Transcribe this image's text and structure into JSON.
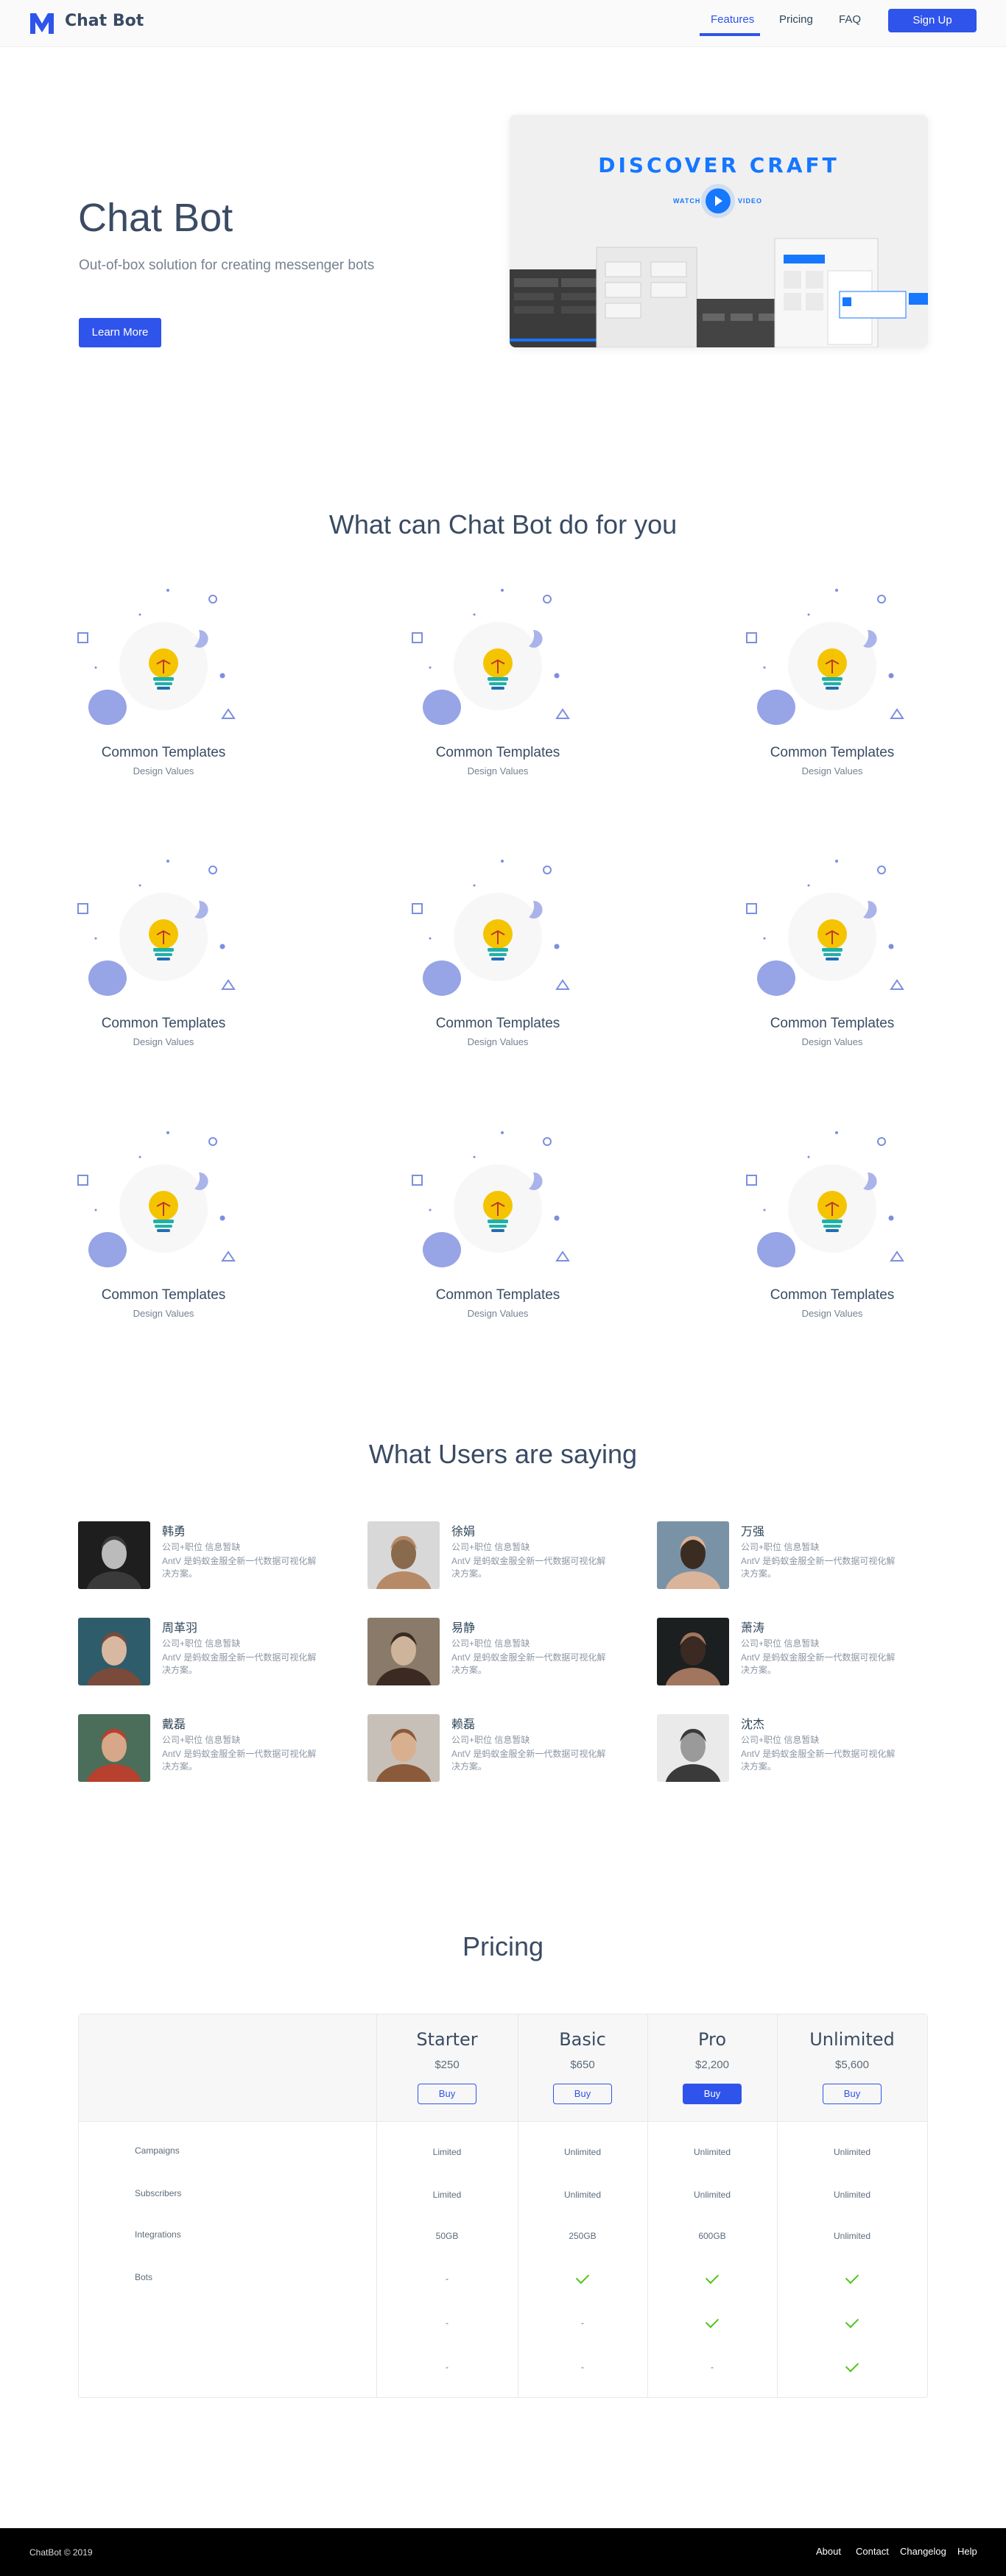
{
  "header": {
    "brand": "Chat Bot",
    "nav": [
      "Features",
      "Pricing",
      "FAQ"
    ],
    "signup": "Sign Up",
    "accent": "#2f54eb"
  },
  "hero": {
    "title": "Chat Bot",
    "subtitle": "Out-of-box solution for creating messenger bots",
    "button": "Learn More",
    "video": {
      "headline": "DISCOVER CRAFT",
      "watch": "WATCH",
      "video": "VIDEO"
    }
  },
  "features": {
    "title": "What can Chat Bot do for you",
    "items": [
      {
        "title": "Common Templates",
        "sub": "Design Values"
      },
      {
        "title": "Common Templates",
        "sub": "Design Values"
      },
      {
        "title": "Common Templates",
        "sub": "Design Values"
      },
      {
        "title": "Common Templates",
        "sub": "Design Values"
      },
      {
        "title": "Common Templates",
        "sub": "Design Values"
      },
      {
        "title": "Common Templates",
        "sub": "Design Values"
      },
      {
        "title": "Common Templates",
        "sub": "Design Values"
      },
      {
        "title": "Common Templates",
        "sub": "Design Values"
      },
      {
        "title": "Common Templates",
        "sub": "Design Values"
      }
    ]
  },
  "testimonials": {
    "title": "What Users are saying",
    "items": [
      {
        "name": "韩勇",
        "role": "公司+职位 信息暂缺",
        "desc": "AntV 是蚂蚁金服全新一代数据可视化解决方案。"
      },
      {
        "name": "徐娟",
        "role": "公司+职位 信息暂缺",
        "desc": "AntV 是蚂蚁金服全新一代数据可视化解决方案。"
      },
      {
        "name": "万强",
        "role": "公司+职位 信息暂缺",
        "desc": "AntV 是蚂蚁金服全新一代数据可视化解决方案。"
      },
      {
        "name": "周革羽",
        "role": "公司+职位 信息暂缺",
        "desc": "AntV 是蚂蚁金服全新一代数据可视化解决方案。"
      },
      {
        "name": "易静",
        "role": "公司+职位 信息暂缺",
        "desc": "AntV 是蚂蚁金服全新一代数据可视化解决方案。"
      },
      {
        "name": "萧涛",
        "role": "公司+职位 信息暂缺",
        "desc": "AntV 是蚂蚁金服全新一代数据可视化解决方案。"
      },
      {
        "name": "戴磊",
        "role": "公司+职位 信息暂缺",
        "desc": "AntV 是蚂蚁金服全新一代数据可视化解决方案。"
      },
      {
        "name": "赖磊",
        "role": "公司+职位 信息暂缺",
        "desc": "AntV 是蚂蚁金服全新一代数据可视化解决方案。"
      },
      {
        "name": "沈杰",
        "role": "公司+职位 信息暂缺",
        "desc": "AntV 是蚂蚁金服全新一代数据可视化解决方案。"
      }
    ]
  },
  "pricing": {
    "title": "Pricing",
    "plans": [
      {
        "name": "Starter",
        "price": "$250",
        "buy": "Buy",
        "primary": false
      },
      {
        "name": "Basic",
        "price": "$650",
        "buy": "Buy",
        "primary": false
      },
      {
        "name": "Pro",
        "price": "$2,200",
        "buy": "Buy",
        "primary": true
      },
      {
        "name": "Unlimited",
        "price": "$5,600",
        "buy": "Buy",
        "primary": false
      }
    ],
    "rows": [
      {
        "label": "Campaigns",
        "cells": [
          "Limited",
          "Unlimited",
          "Unlimited",
          "Unlimited"
        ]
      },
      {
        "label": "Subscribers",
        "cells": [
          "Limited",
          "Unlimited",
          "Unlimited",
          "Unlimited"
        ]
      },
      {
        "label": "Integrations",
        "cells": [
          "50GB",
          "250GB",
          "600GB",
          "Unlimited"
        ]
      },
      {
        "label": "Bots",
        "cells": [
          "-",
          "check",
          "check",
          "check"
        ]
      },
      {
        "label": "",
        "cells": [
          "-",
          "-",
          "check",
          "check"
        ]
      },
      {
        "label": "",
        "cells": [
          "-",
          "-",
          "-",
          "check"
        ]
      }
    ]
  },
  "footer": {
    "copyright": "ChatBot © 2019",
    "links": [
      "About",
      "Contact",
      "Changelog",
      "Help"
    ]
  }
}
